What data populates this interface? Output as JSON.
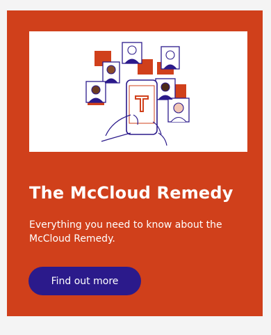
{
  "card": {
    "title": "The McCloud Remedy",
    "description": "Everything you need to know about the McCloud Remedy.",
    "cta_label": "Find out more",
    "colors": {
      "background": "#d0401b",
      "button": "#2b1a8b",
      "text": "#ffffff"
    },
    "hero_icon": "video-call-illustration"
  }
}
